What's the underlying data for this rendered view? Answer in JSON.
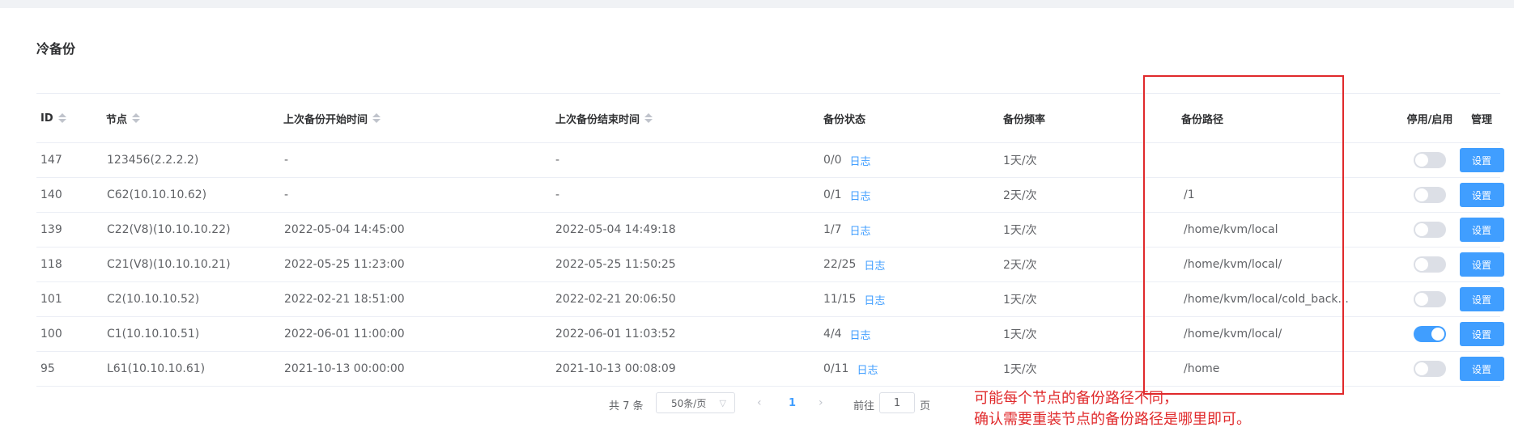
{
  "page": {
    "title": "冷备份"
  },
  "table": {
    "columns": {
      "id": "ID",
      "node": "节点",
      "start": "上次备份开始时间",
      "end": "上次备份结束时间",
      "status": "备份状态",
      "freq": "备份频率",
      "path": "备份路径",
      "toggle": "停用/启用",
      "manage": "管理"
    },
    "log_label": "日志",
    "manage_label": "设置",
    "rows": [
      {
        "id": "147",
        "node": "123456(2.2.2.2)",
        "start": "-",
        "end": "-",
        "status": "0/0",
        "freq": "1天/次",
        "path": "",
        "enabled": false
      },
      {
        "id": "140",
        "node": "C62(10.10.10.62)",
        "start": "-",
        "end": "-",
        "status": "0/1",
        "freq": "2天/次",
        "path": "/1",
        "enabled": false
      },
      {
        "id": "139",
        "node": "C22(V8)(10.10.10.22)",
        "start": "2022-05-04 14:45:00",
        "end": "2022-05-04 14:49:18",
        "status": "1/7",
        "freq": "1天/次",
        "path": "/home/kvm/local",
        "enabled": false
      },
      {
        "id": "118",
        "node": "C21(V8)(10.10.10.21)",
        "start": "2022-05-25 11:23:00",
        "end": "2022-05-25 11:50:25",
        "status": "22/25",
        "freq": "2天/次",
        "path": "/home/kvm/local/",
        "enabled": false
      },
      {
        "id": "101",
        "node": "C2(10.10.10.52)",
        "start": "2022-02-21 18:51:00",
        "end": "2022-02-21 20:06:50",
        "status": "11/15",
        "freq": "1天/次",
        "path": "/home/kvm/local/cold_back...",
        "enabled": false
      },
      {
        "id": "100",
        "node": "C1(10.10.10.51)",
        "start": "2022-06-01 11:00:00",
        "end": "2022-06-01 11:03:52",
        "status": "4/4",
        "freq": "1天/次",
        "path": "/home/kvm/local/",
        "enabled": true
      },
      {
        "id": "95",
        "node": "L61(10.10.10.61)",
        "start": "2021-10-13 00:00:00",
        "end": "2021-10-13 00:08:09",
        "status": "0/11",
        "freq": "1天/次",
        "path": "/home",
        "enabled": false
      }
    ]
  },
  "pagination": {
    "total": "共 7 条",
    "page_size": "50条/页",
    "current_page": "1",
    "goto_label": "前往",
    "goto_value": "1",
    "page_unit": "页"
  },
  "annotation": {
    "line1": "可能每个节点的备份路径不同，",
    "line2": "确认需要重装节点的备份路径是哪里即可。",
    "color": "#e0292b"
  },
  "colors": {
    "accent": "#409eff"
  }
}
